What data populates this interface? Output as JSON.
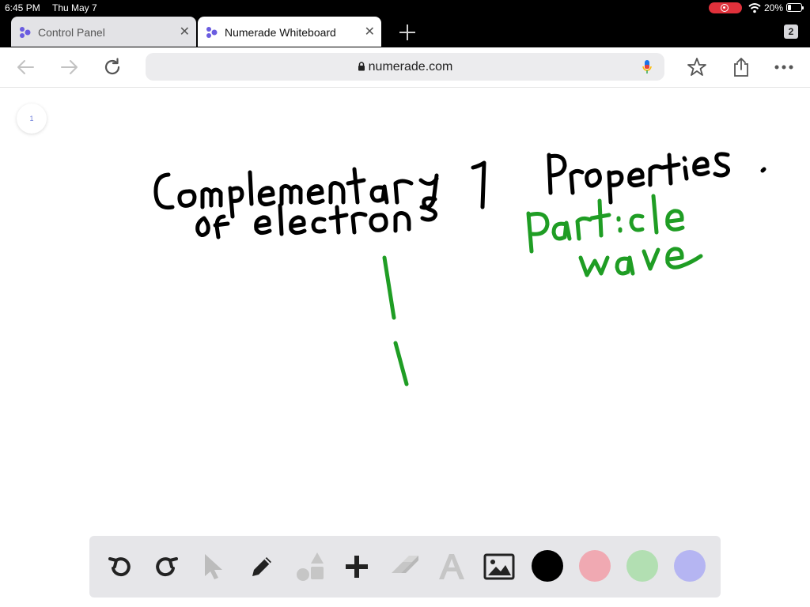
{
  "status": {
    "time": "6:45 PM",
    "date": "Thu May 7",
    "battery": "20%"
  },
  "tabs": [
    {
      "label": "Control Panel",
      "active": false
    },
    {
      "label": "Numerade Whiteboard",
      "active": true
    }
  ],
  "tab_count": "2",
  "new_tab_icon": "plus-icon",
  "address": {
    "url": "numerade.com"
  },
  "nav_icons": [
    "back-arrow-icon",
    "forward-arrow-icon",
    "reload-icon",
    "microphone-icon",
    "star-icon",
    "share-icon",
    "more-icon"
  ],
  "page": {
    "number": "1"
  },
  "whiteboard": {
    "strokes": [
      {
        "text": "Complementary",
        "color": "#000000"
      },
      {
        "text": "of electrons",
        "color": "#000000"
      },
      {
        "text": "Properties",
        "color": "#000000"
      },
      {
        "text": "Particle",
        "color": "#1f9d24"
      },
      {
        "text": "wave",
        "color": "#1f9d24"
      }
    ]
  },
  "toolbar": {
    "tools": [
      "undo-icon",
      "redo-icon",
      "select-arrow-icon",
      "pencil-icon",
      "shapes-icon",
      "add-icon",
      "eraser-icon",
      "text-icon",
      "image-icon"
    ],
    "colors": [
      "#000000",
      "#f0a9b2",
      "#b2dfb2",
      "#b5b5f2"
    ],
    "selected_color": "#000000"
  }
}
